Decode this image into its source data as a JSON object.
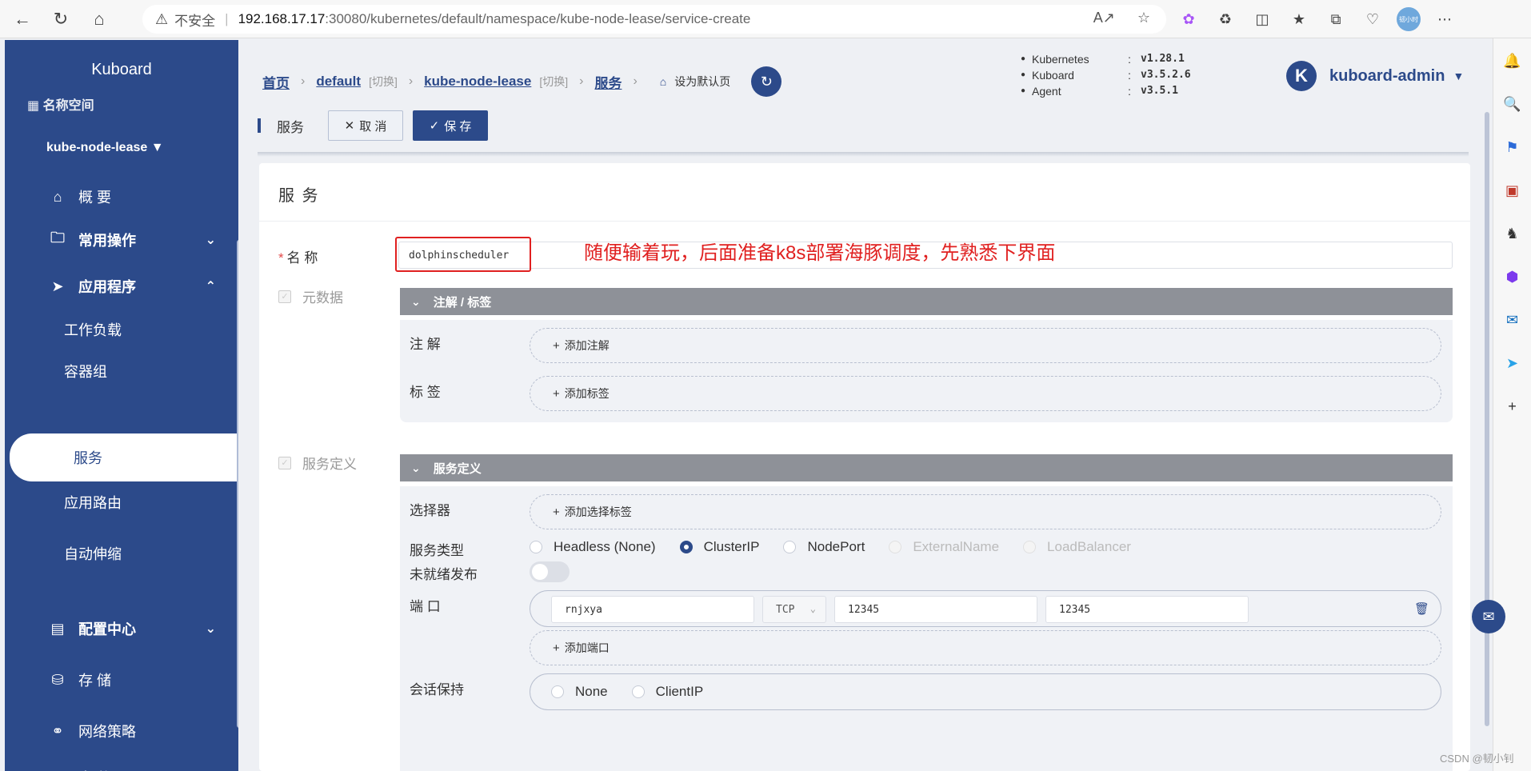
{
  "browser": {
    "url_prefix": "不安全",
    "url_host": "192.168.17.17",
    "url_path": ":30080/kubernetes/default/namespace/kube-node-lease/service-create",
    "profile_label": "韧小时"
  },
  "sidebar": {
    "brand": "Kuboard",
    "ns_head": "名称空间",
    "ns_select": "kube-node-lease",
    "items": [
      {
        "label": "概 要"
      },
      {
        "label": "常用操作"
      },
      {
        "label": "应用程序"
      },
      {
        "label": "工作负载"
      },
      {
        "label": "容器组"
      },
      {
        "label": "服务"
      },
      {
        "label": "应用路由"
      },
      {
        "label": "自动伸缩"
      },
      {
        "label": "配置中心"
      },
      {
        "label": "存 储"
      },
      {
        "label": "网络策略"
      },
      {
        "label": "事 件"
      }
    ]
  },
  "header": {
    "crumbs": {
      "home": "首页",
      "cluster": "default",
      "switch1": "[切换]",
      "namespace": "kube-node-lease",
      "switch2": "[切换]",
      "current": "服务",
      "set_default": "设为默认页"
    },
    "versions": [
      {
        "name": "Kubernetes",
        "value": "v1.28.1"
      },
      {
        "name": "Kuboard",
        "value": "v3.5.2.6"
      },
      {
        "name": "Agent",
        "value": "v3.5.1"
      }
    ],
    "user_initial": "K",
    "user_name": "kuboard-admin"
  },
  "toolbar": {
    "title": "服务",
    "cancel": "取 消",
    "save": "保 存"
  },
  "form": {
    "card_title": "服 务",
    "name_label": "名 称",
    "name_value": "dolphinscheduler",
    "annotation": "随便输着玩，后面准备k8s部署海豚调度，先熟悉下界面",
    "metadata_label": "元数据",
    "meta_section": "注解 / 标签",
    "annotations_label": "注 解",
    "add_annotation": "添加注解",
    "labels_label": "标 签",
    "add_label": "添加标签",
    "svcdef_label": "服务定义",
    "svcdef_section": "服务定义",
    "selector_label": "选择器",
    "add_selector": "添加选择标签",
    "svc_type_label": "服务类型",
    "svc_types": [
      {
        "label": "Headless (None)",
        "state": "unchecked"
      },
      {
        "label": "ClusterIP",
        "state": "checked"
      },
      {
        "label": "NodePort",
        "state": "unchecked"
      },
      {
        "label": "ExternalName",
        "state": "disabled"
      },
      {
        "label": "LoadBalancer",
        "state": "disabled"
      }
    ],
    "unready_label": "未就绪发布",
    "unready_on": false,
    "port_label": "端 口",
    "port": {
      "name": "rnjxya",
      "protocol": "TCP",
      "port": "12345",
      "target_port": "12345"
    },
    "add_port": "添加端口",
    "session_label": "会话保持",
    "session_options": [
      {
        "label": "None"
      },
      {
        "label": "ClientIP"
      }
    ]
  },
  "watermark": "CSDN @韧小钊"
}
